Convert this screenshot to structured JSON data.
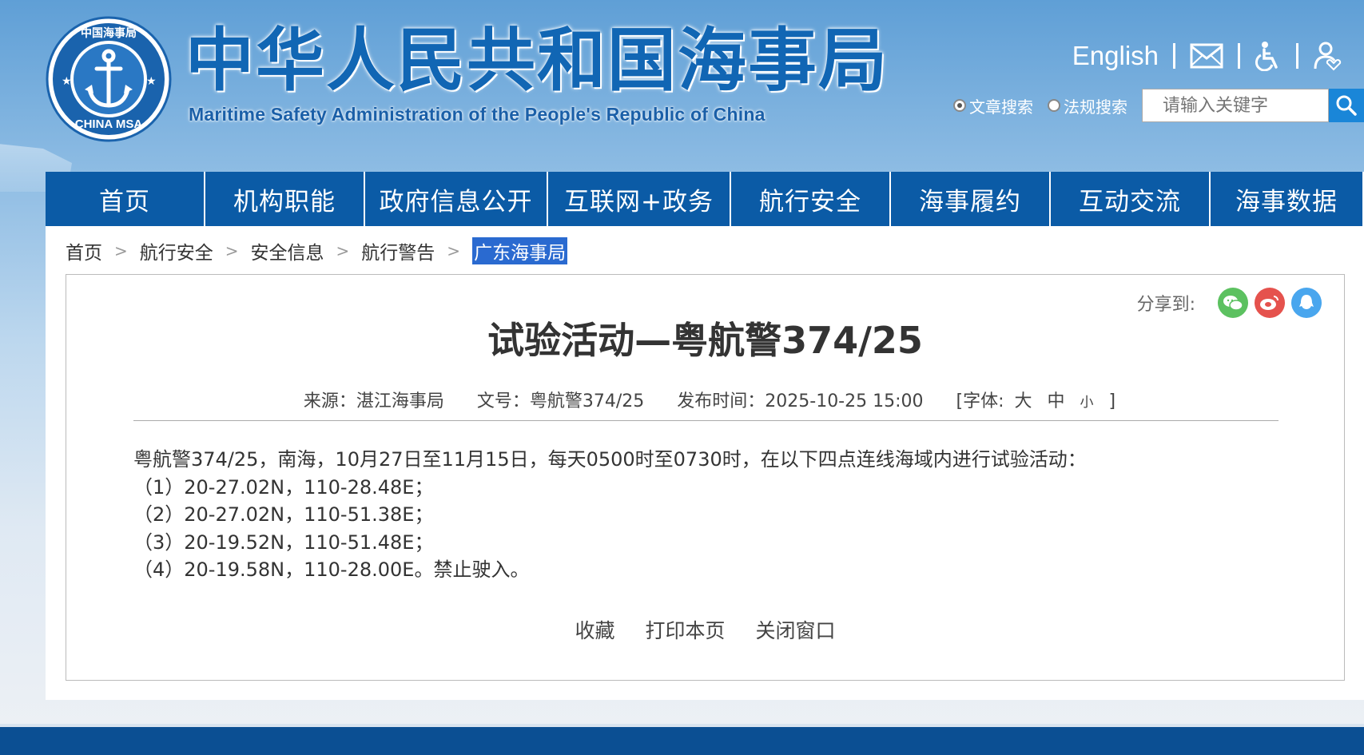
{
  "header": {
    "title_cn": "中华人民共和国海事局",
    "title_en": "Maritime Safety Administration of the People's Republic of China",
    "logo_text_top": "中国海事局",
    "logo_text_bottom": "CHINA MSA",
    "english_link": "English",
    "icons": [
      "mail-icon",
      "accessibility-icon",
      "care-mode-icon"
    ]
  },
  "search": {
    "options": [
      "文章搜索",
      "法规搜索"
    ],
    "selected": "文章搜索",
    "placeholder": "请输入关键字"
  },
  "nav": {
    "items": [
      "首页",
      "机构职能",
      "政府信息公开",
      "互联网+政务",
      "航行安全",
      "海事履约",
      "互动交流",
      "海事数据"
    ]
  },
  "breadcrumb": [
    "首页",
    "航行安全",
    "安全信息",
    "航行警告",
    "广东海事局"
  ],
  "share": {
    "label": "分享到:",
    "icons": [
      "wechat-icon",
      "weibo-icon",
      "qq-icon"
    ],
    "colors": {
      "wechat": "#5cc160",
      "weibo": "#e5524d",
      "qq": "#49a6ee"
    }
  },
  "article": {
    "title": "试验活动—粤航警374/25",
    "source": "来源：湛江海事局",
    "doc_no": "文号：粤航警374/25",
    "published": "发布时间：2025-10-25 15:00",
    "font_label": "[字体:",
    "font_large": "大",
    "font_medium": "中",
    "font_small": "小",
    "font_close": "]",
    "body": [
      "粤航警374/25，南海，10月27日至11月15日，每天0500时至0730时，在以下四点连线海域内进行试验活动：",
      "（1）20-27.02N，110-28.48E；",
      "（2）20-27.02N，110-51.38E；",
      "（3）20-19.52N，110-51.48E；",
      "（4）20-19.58N，110-28.00E。禁止驶入。"
    ],
    "actions": [
      "收藏",
      "打印本页",
      "关闭窗口"
    ]
  },
  "colors": {
    "nav_bg": "#0b5ba6",
    "title_blue": "#1166b4",
    "breadcrumb_highlight": "#2a6ad0",
    "footer": "#0b4f93"
  }
}
